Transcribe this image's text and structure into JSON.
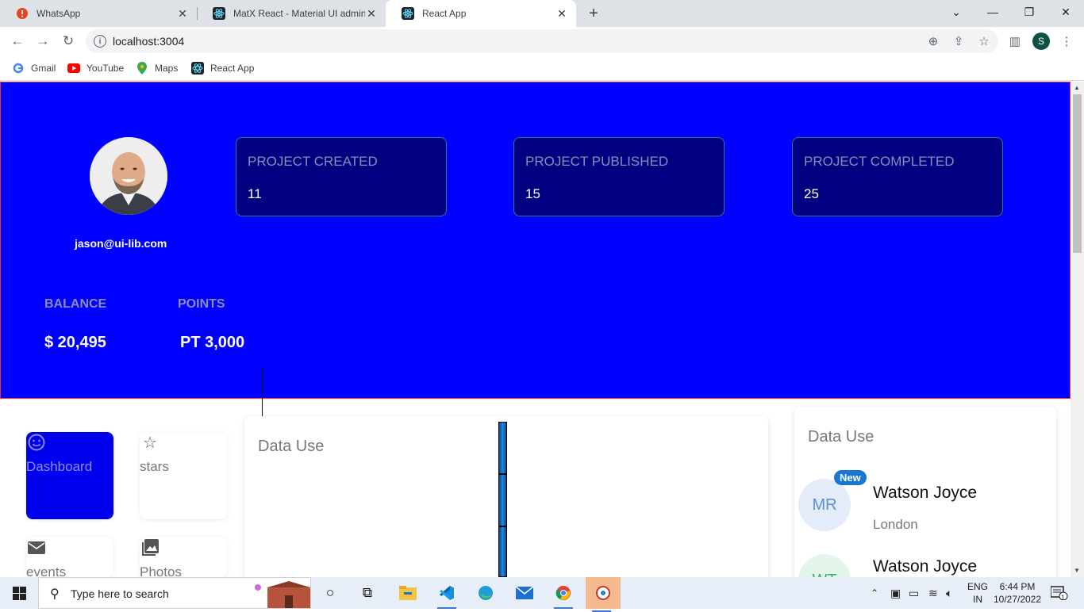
{
  "browser": {
    "tabs": [
      {
        "title": "WhatsApp"
      },
      {
        "title": "MatX React - Material UI admin d"
      },
      {
        "title": "React App"
      }
    ],
    "address": "localhost:3004",
    "profile_initial": "S",
    "bookmarks": [
      {
        "label": "Gmail"
      },
      {
        "label": "YouTube"
      },
      {
        "label": "Maps"
      },
      {
        "label": "React App"
      }
    ]
  },
  "hero": {
    "email": "jason@ui-lib.com",
    "stats": [
      {
        "label": "PROJECT CREATED",
        "value": "11"
      },
      {
        "label": "PROJECT PUBLISHED",
        "value": "15"
      },
      {
        "label": "PROJECT COMPLETED",
        "value": "25"
      }
    ],
    "balance_label": "BALANCE",
    "balance_value": "$ 20,495",
    "points_label": "POINTS",
    "points_value": "PT 3,000"
  },
  "nav_cards": [
    {
      "label": "Dashboard",
      "icon": "smiley-icon"
    },
    {
      "label": "stars",
      "icon": "star-icon"
    },
    {
      "label": "events",
      "icon": "mail-icon"
    },
    {
      "label": "Photos",
      "icon": "photo-icon"
    }
  ],
  "data_use_chart": {
    "title": "Data Use"
  },
  "contacts_panel": {
    "title": "Data Use",
    "contacts": [
      {
        "initials": "MR",
        "badge": "New",
        "name": "Watson Joyce",
        "city": "London"
      },
      {
        "initials": "WT",
        "name": "Watson Joyce"
      }
    ]
  },
  "taskbar": {
    "search_placeholder": "Type here to search",
    "language": "ENG",
    "region": "IN",
    "time": "6:44 PM",
    "date": "10/27/2022",
    "notification_count": "1"
  },
  "colors": {
    "hero_bg": "#0000ff",
    "card_bg": "#000080",
    "active_nav": "#0000ee"
  }
}
